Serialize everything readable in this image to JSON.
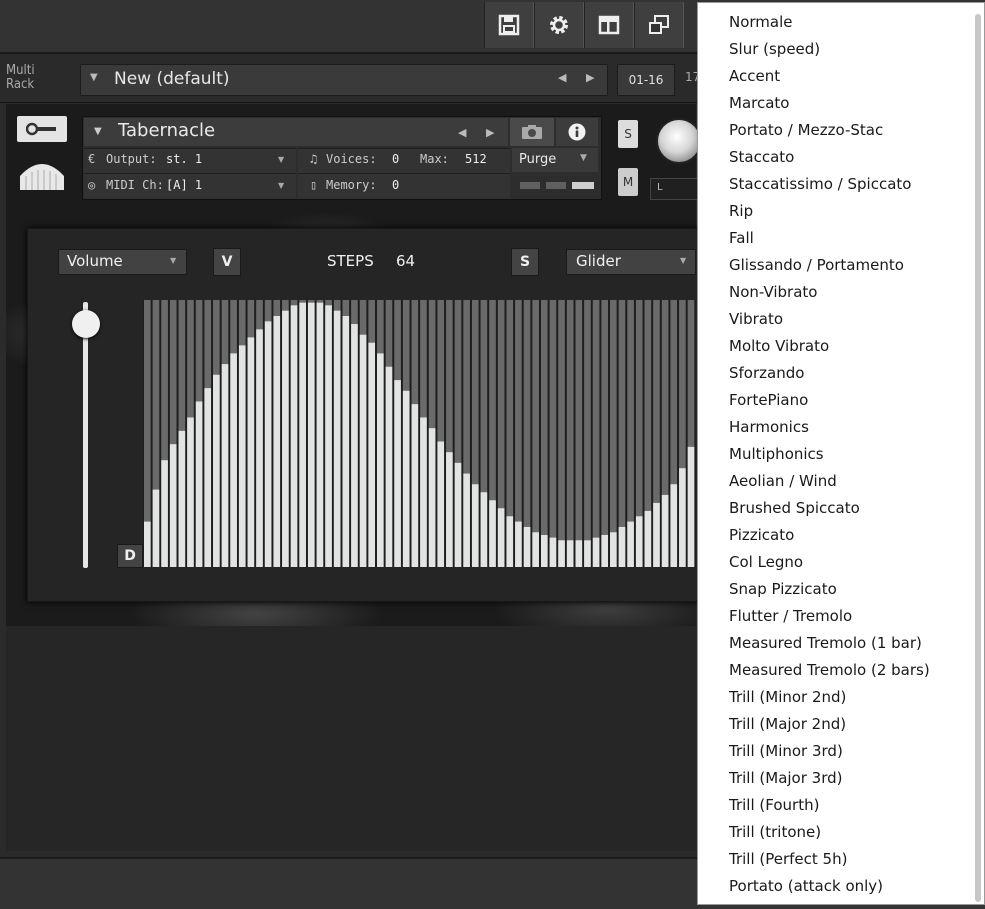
{
  "toolbar": {
    "buttons": [
      "save-icon",
      "gear-icon",
      "layout-icon",
      "minimize-view-icon"
    ]
  },
  "rack": {
    "label": "Multi\nRack",
    "name": "New (default)",
    "midi_range": "01-16",
    "midi_range_2": "17"
  },
  "instrument": {
    "name": "Tabernacle",
    "output_label": "Output:",
    "output_value": "st. 1",
    "voices_label": "Voices:",
    "voices_value": "0",
    "max_label": "Max:",
    "max_value": "512",
    "midi_label": "MIDI Ch:",
    "midi_value": "[A]  1",
    "memory_label": "Memory:",
    "memory_value": "0",
    "purge_label": "Purge",
    "solo_label": "S",
    "mute_label": "M",
    "pan_label": "L"
  },
  "sequencer": {
    "param": "Volume",
    "v_label": "V",
    "steps_label": "STEPS",
    "steps_value": "64",
    "s_label": "S",
    "mode": "Glider",
    "d_label": "D",
    "slider_level": 0.93,
    "step_values": [
      0.17,
      0.29,
      0.4,
      0.46,
      0.51,
      0.56,
      0.62,
      0.67,
      0.72,
      0.76,
      0.8,
      0.83,
      0.86,
      0.89,
      0.92,
      0.94,
      0.96,
      0.98,
      0.99,
      0.99,
      0.99,
      0.98,
      0.96,
      0.94,
      0.91,
      0.87,
      0.84,
      0.8,
      0.75,
      0.7,
      0.66,
      0.61,
      0.56,
      0.52,
      0.47,
      0.43,
      0.39,
      0.35,
      0.31,
      0.28,
      0.25,
      0.22,
      0.19,
      0.17,
      0.15,
      0.13,
      0.12,
      0.11,
      0.1,
      0.1,
      0.1,
      0.1,
      0.11,
      0.12,
      0.13,
      0.15,
      0.17,
      0.19,
      0.21,
      0.24,
      0.27,
      0.31,
      0.37,
      0.45
    ],
    "visible_steps": 64
  },
  "menu": {
    "items": [
      "Normale",
      "Slur (speed)",
      "Accent",
      "Marcato",
      "Portato / Mezzo-Stac",
      "Staccato",
      "Staccatissimo / Spiccato",
      "Rip",
      "Fall",
      "Glissando / Portamento",
      "Non-Vibrato",
      "Vibrato",
      "Molto Vibrato",
      "Sforzando",
      "FortePiano",
      "Harmonics",
      "Multiphonics",
      "Aeolian / Wind",
      "Brushed Spiccato",
      "Pizzicato",
      "Col Legno",
      "Snap Pizzicato",
      "Flutter / Tremolo",
      "Measured Tremolo (1 bar)",
      "Measured Tremolo (2 bars)",
      "Trill (Minor 2nd)",
      "Trill (Major 2nd)",
      "Trill (Minor 3rd)",
      "Trill (Major 3rd)",
      "Trill (Fourth)",
      "Trill (tritone)",
      "Trill (Perfect 5h)",
      "Portato (attack only)"
    ]
  },
  "colors": {
    "background": "#2b2b2b",
    "step_bar": "#e2e4e4",
    "step_bg": "#6a6a6a",
    "menu_bg": "#ffffff",
    "menu_text": "#1a1a1a"
  }
}
